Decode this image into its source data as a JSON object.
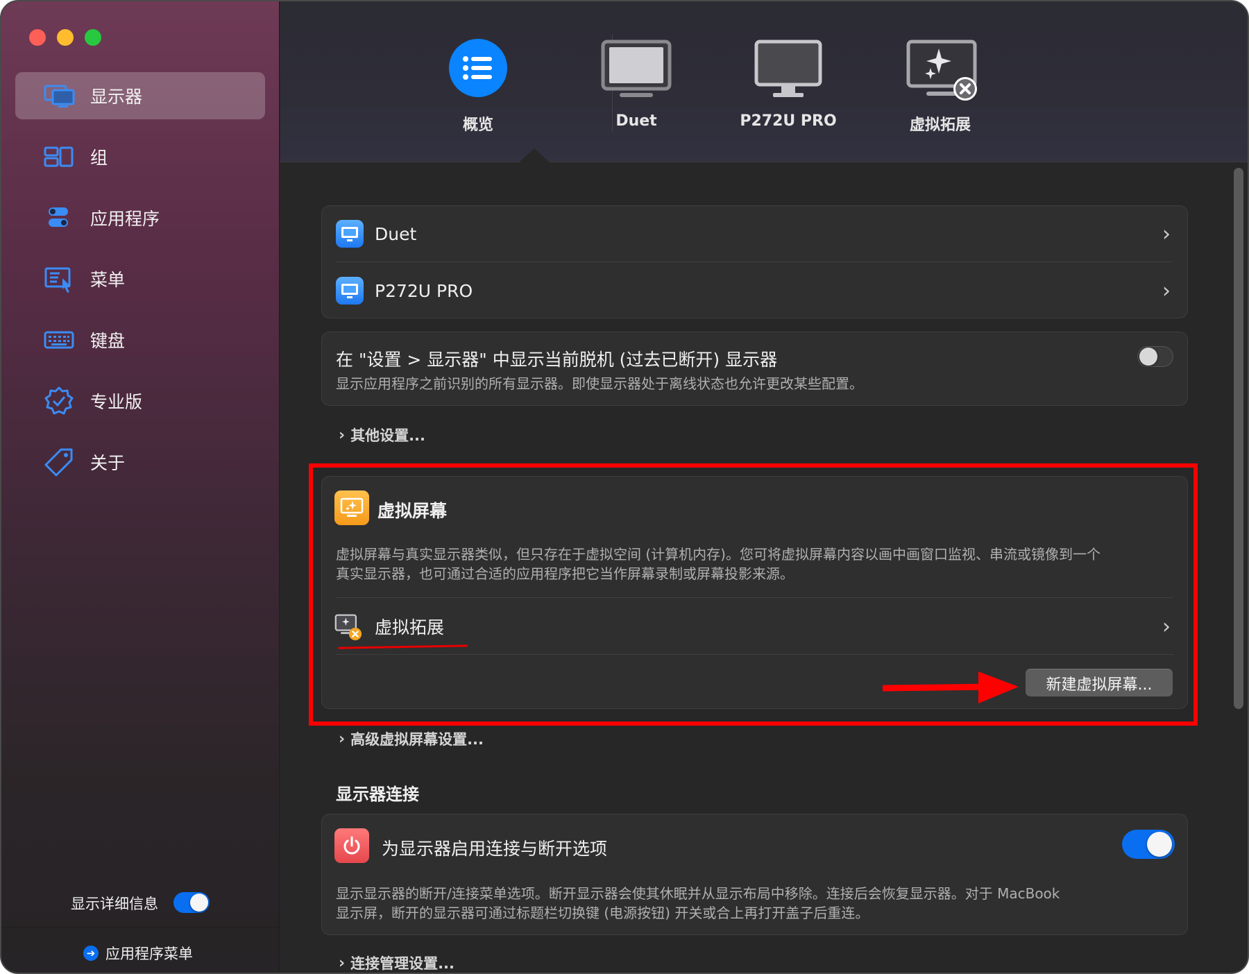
{
  "sidebar": {
    "items": [
      {
        "label": "显示器",
        "icon": "displays-icon"
      },
      {
        "label": "组",
        "icon": "groups-icon"
      },
      {
        "label": "应用程序",
        "icon": "app-toggles-icon"
      },
      {
        "label": "菜单",
        "icon": "menu-icon"
      },
      {
        "label": "键盘",
        "icon": "keyboard-icon"
      },
      {
        "label": "专业版",
        "icon": "pro-badge-icon"
      },
      {
        "label": "关于",
        "icon": "tag-icon"
      }
    ],
    "show_details_label": "显示详细信息",
    "show_details_on": true,
    "app_menu_label": "应用程序菜单"
  },
  "tabs": [
    {
      "label": "概览",
      "icon": "list-icon",
      "selected": true
    },
    {
      "label": "Duet",
      "icon": "monitor-icon"
    },
    {
      "label": "P272U PRO",
      "icon": "monitor-stand-icon"
    },
    {
      "label": "虚拟拓展",
      "icon": "virtual-display-icon"
    }
  ],
  "displays": [
    {
      "label": "Duet"
    },
    {
      "label": "P272U PRO"
    }
  ],
  "offline_setting": {
    "title": "在 \"设置 > 显示器\" 中显示当前脱机 (过去已断开) 显示器",
    "description": "显示应用程序之前识别的所有显示器。即使显示器处于离线状态也允许更改某些配置。",
    "enabled": false
  },
  "other_settings_label": "其他设置...",
  "virtual_screens": {
    "title": "虚拟屏幕",
    "description_line1": "虚拟屏幕与真实显示器类似，但只存在于虚拟空间 (计算机内存)。您可将虚拟屏幕内容以画中画窗口监视、串流或镜像到一个",
    "description_line2": "真实显示器，也可通过合适的应用程序把它当作屏幕录制或屏幕投影来源。",
    "item_label": "虚拟拓展",
    "new_button": "新建虚拟屏幕..."
  },
  "advanced_virtual_label": "高级虚拟屏幕设置...",
  "connection": {
    "heading": "显示器连接",
    "title": "为显示器启用连接与断开选项",
    "description_line1": "显示显示器的断开/连接菜单选项。断开显示器会使其休眠并从显示布局中移除。连接后会恢复显示器。对于 MacBook",
    "description_line2": "显示屏，断开的显示器可通过标题栏切换键 (电源按钮) 开关或合上再打开盖子后重连。",
    "enabled": true
  },
  "connection_settings_label": "连接管理设置...",
  "colors": {
    "accent": "#0a6ef0",
    "annotation": "#ff0000",
    "virtual_icon": "#f5a623",
    "power_icon": "#e5484d"
  }
}
